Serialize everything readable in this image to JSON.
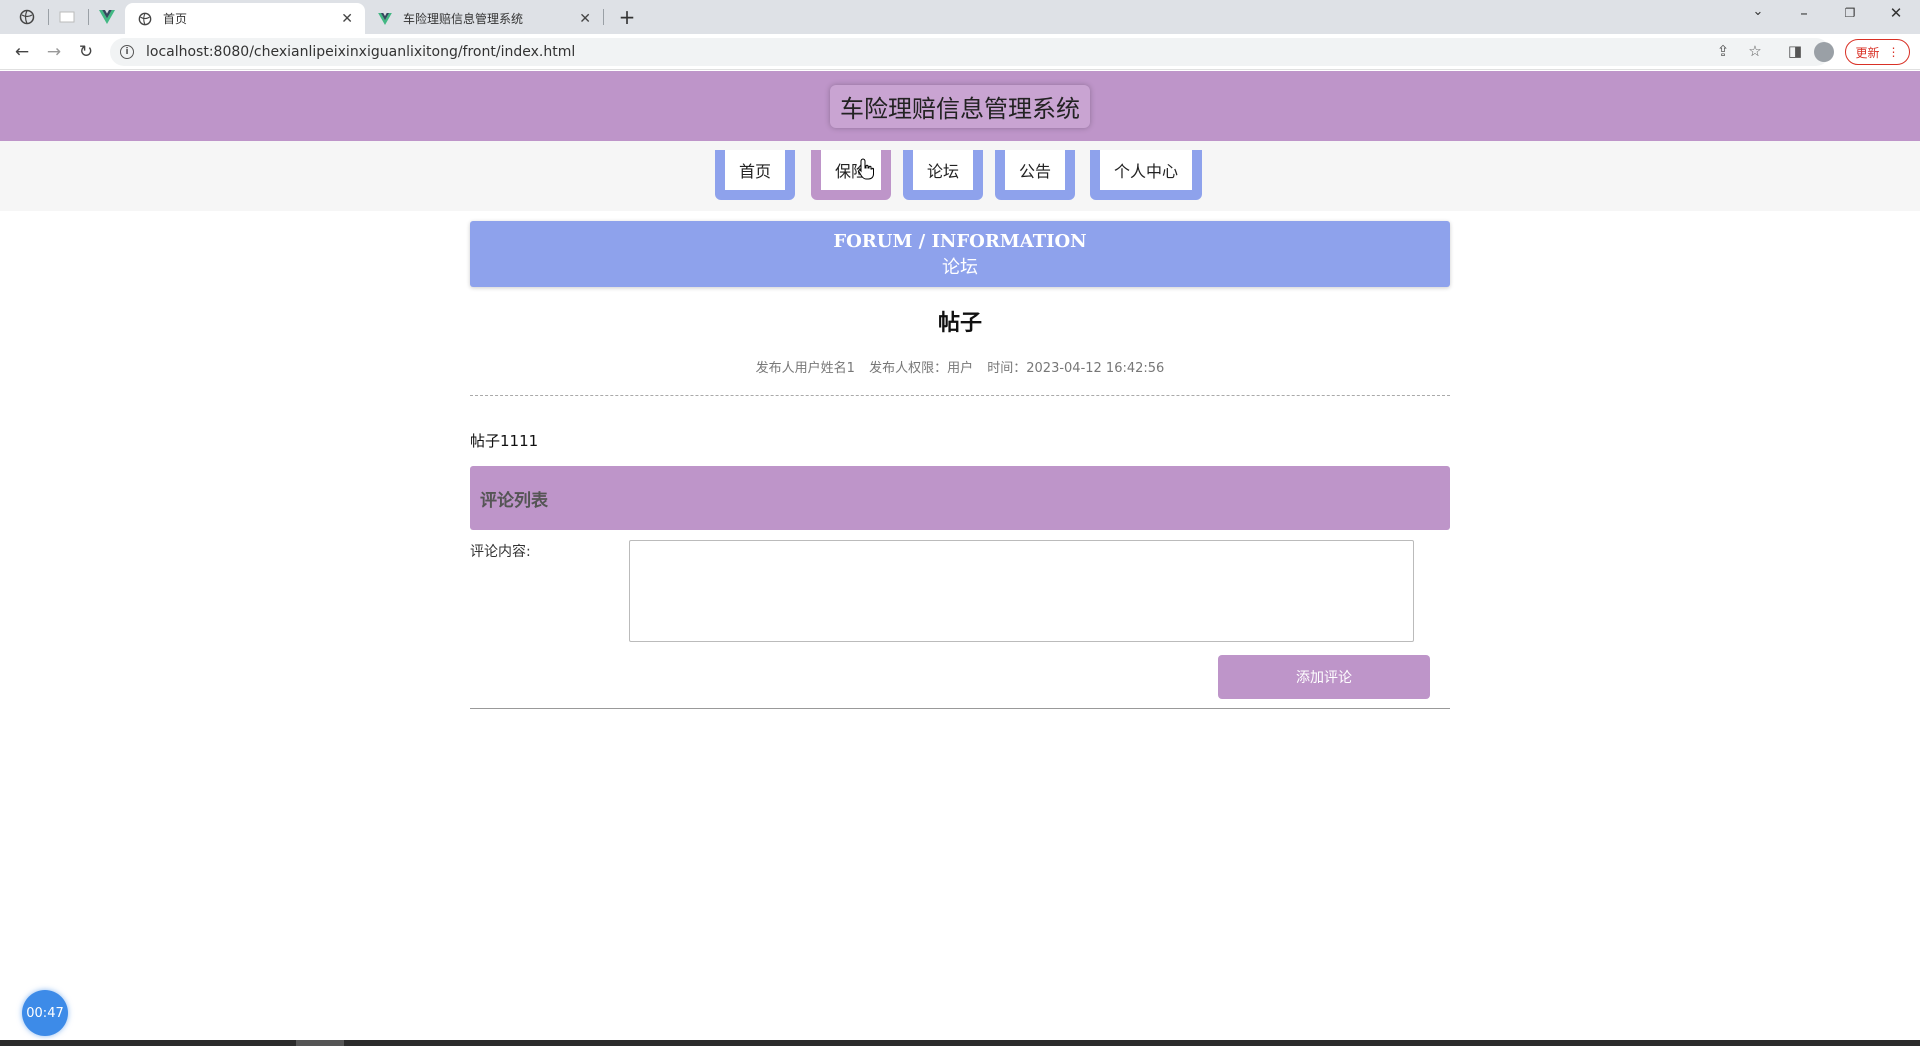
{
  "browser": {
    "tabs": [
      {
        "title": "首页",
        "active": true
      },
      {
        "title": "车险理赔信息管理系统",
        "active": false
      }
    ],
    "url": "localhost:8080/chexianlipeixinxiguanlixitong/front/index.html",
    "update_label": "更新"
  },
  "site": {
    "title": "车险理赔信息管理系统"
  },
  "nav": {
    "items": [
      {
        "label": "首页",
        "color": "#8ea2ec"
      },
      {
        "label": "保险",
        "color": "#be95c9"
      },
      {
        "label": "论坛",
        "color": "#8ea2ec"
      },
      {
        "label": "公告",
        "color": "#8ea2ec"
      },
      {
        "label": "个人中心",
        "color": "#8ea2ec"
      }
    ]
  },
  "banner": {
    "en": "FORUM / INFORMATION",
    "cn": "论坛"
  },
  "post": {
    "title": "帖子",
    "author": "发布人用户姓名1",
    "role": "发布人权限：用户",
    "time": "时间：2023-04-12 16:42:56",
    "content": "帖子1111"
  },
  "comments": {
    "header": "评论列表",
    "label": "评论内容:",
    "input_value": "",
    "submit_label": "添加评论"
  },
  "timer": "00:47",
  "colors": {
    "purple": "#be95c9",
    "blue": "#8ea2ec"
  }
}
